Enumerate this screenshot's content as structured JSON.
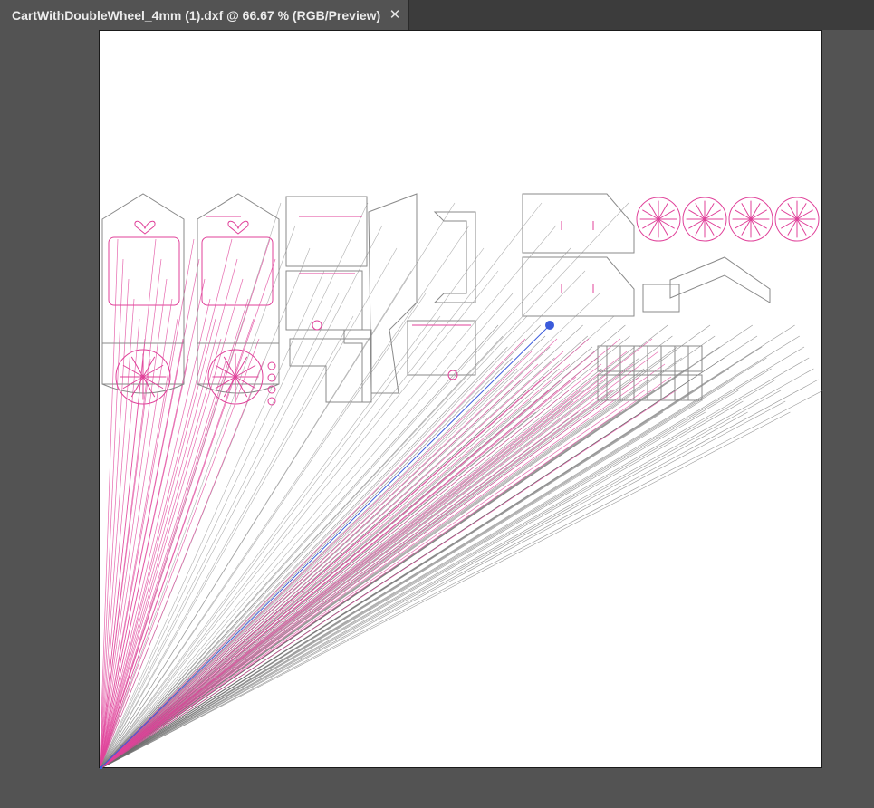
{
  "window": {
    "tab_title": "CartWithDoubleWheel_4mm (1).dxf @ 66.67 % (RGB/Preview)",
    "close_glyph": "✕"
  },
  "colors": {
    "workspace": "#535353",
    "tabbar": "#3c3c3c",
    "artboard": "#ffffff",
    "cut_gray": "#8a8a8a",
    "cut_pink": "#e0429a",
    "selection_blue": "#3b5bdb"
  }
}
